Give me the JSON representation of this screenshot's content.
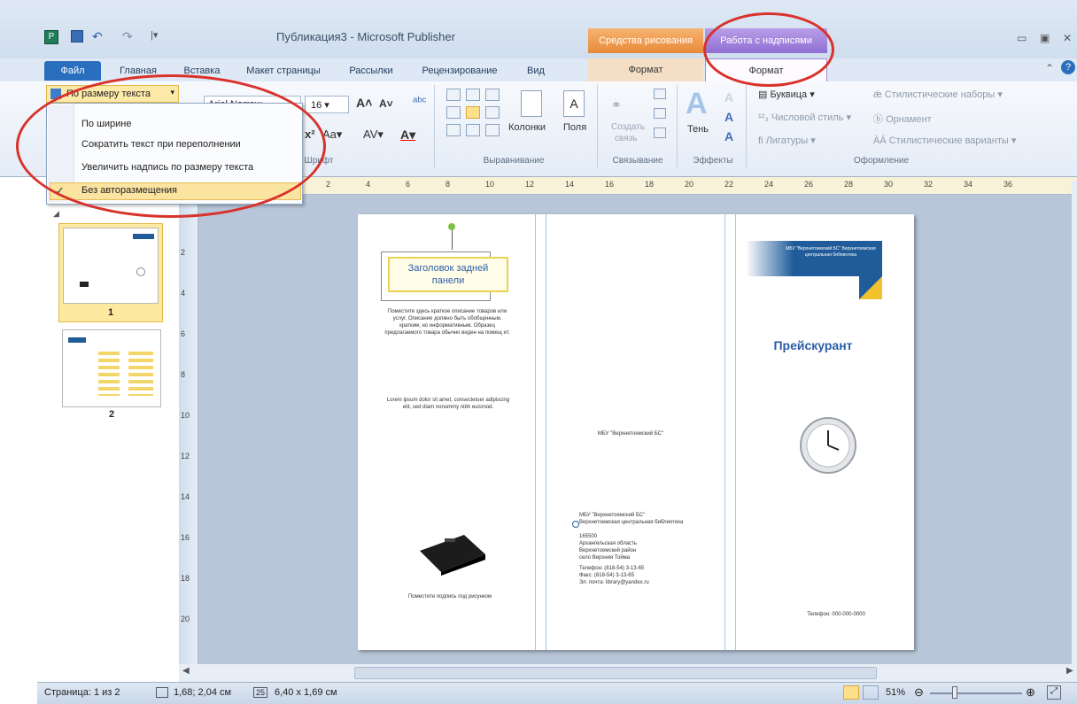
{
  "window": {
    "title": "Публикация3 - Microsoft Publisher",
    "contextual_group_drawing": "Средства рисования",
    "contextual_group_textbox": "Работа с надписями",
    "contextual_tab_format_drawing": "Формат",
    "contextual_tab_format_textbox": "Формат"
  },
  "tabs": [
    "Файл",
    "Главная",
    "Вставка",
    "Макет страницы",
    "Рассылки",
    "Рецензирование",
    "Вид"
  ],
  "ribbon": {
    "fit_button": "По размеру текста",
    "font_name": "Arial Narrow",
    "font_size": "16",
    "group_font": "Шрифт",
    "columns_label": "Колонки",
    "margins_label": "Поля",
    "group_alignment": "Выравнивание",
    "create_label": "Создать",
    "link_label": "связь",
    "group_linking": "Связывание",
    "shadow_label": "Тень",
    "group_effects": "Эффекты",
    "drop_cap": "Буквица",
    "number_style": "Числовой стиль",
    "ligatures": "Лигатуры",
    "stylistic_sets": "Стилистические наборы",
    "ornament": "Орнамент",
    "stylistic_alternates": "Стилистические варианты",
    "group_typography": "Оформление"
  },
  "dropdown": {
    "items": [
      "По ширине",
      "Сократить текст при переполнении",
      "Увеличить надпись по размеру текста",
      "Без авторазмещения"
    ],
    "checked_index": 3
  },
  "ruler": {
    "h_ticks": [
      "2",
      "4",
      "6",
      "8",
      "10",
      "12",
      "14",
      "16",
      "18",
      "20",
      "22",
      "24",
      "26",
      "28",
      "30",
      "32",
      "34",
      "36"
    ],
    "v_ticks": [
      "2",
      "4",
      "6",
      "8",
      "10",
      "12",
      "14",
      "16",
      "18",
      "20"
    ]
  },
  "pages": [
    {
      "number": "1",
      "selected": true
    },
    {
      "number": "2",
      "selected": false
    }
  ],
  "document": {
    "heading_back_panel": "Заголовок задней панели",
    "body_text_1": "Поместите здесь краткое описание товаров или услуг. Описание должно быть обобщенным, кратким, но информативным. Образец предлагаемого товара обычно виден на помещ ит.",
    "body_text_2": "Lorem ipsum dolor sit amet, consectetuer adipiscing elit, sed diam nonummy nibh euismod.",
    "caption_left": "Поместите подпись под рисунком",
    "center_line": "МБУ \"Верхнетоемский БС\"",
    "address_lines": [
      "МБУ \"Верхнетоемский БС\"",
      "Верхнетоемская центральная библиотека",
      "165500",
      "Архангельская область",
      "Верхнетоемский район",
      "село Верхняя Тойма",
      "Телефон: (818-54) 3-13-65",
      "Факс: (818-54) 3-13-65",
      "Эл. почта: library@yandex.ru"
    ],
    "banner_text": "МБУ \"Верхнетоемский БС\" Верхнетоемская центральная библиотека",
    "price_list": "Прейскурант",
    "phone_right": "Телефон: 000-000-0000"
  },
  "status": {
    "page": "Страница: 1 из 2",
    "position": "1,68; 2,04 см",
    "size": "6,40 x 1,69 см",
    "zoom": "51%"
  },
  "colors": {
    "accent_blue": "#2a6fbd",
    "highlight": "#d8322b",
    "textbox_border": "#e8d44e"
  }
}
